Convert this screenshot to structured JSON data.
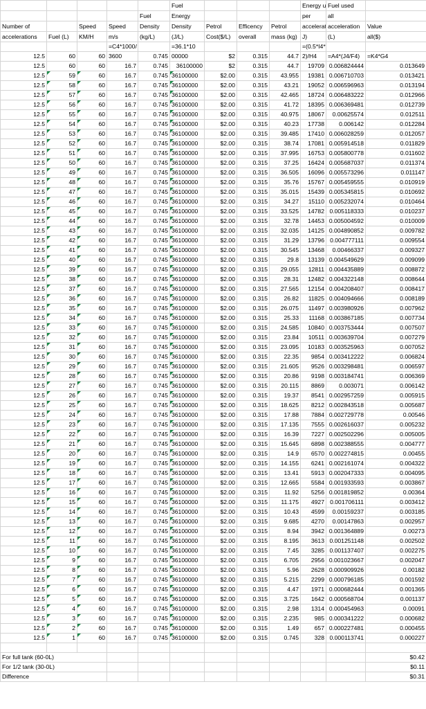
{
  "headers": {
    "row1": [
      "",
      "",
      "",
      "",
      "Fuel",
      "",
      "",
      "",
      "Energy used",
      "Fuel used",
      ""
    ],
    "row2": [
      "",
      "",
      "",
      "Fuel",
      "Energy",
      "",
      "",
      "",
      "per",
      "all",
      ""
    ],
    "row3": [
      "Number of",
      "",
      "Speed",
      "Speed",
      "Density",
      "Density",
      "Petrol",
      "Efficency",
      "Petrol",
      "acceleration(",
      "acceleration",
      "Value"
    ],
    "row4": [
      "accelerations",
      "Fuel (L)",
      "KM/H",
      "m/s",
      "(kg/L)",
      "(J/L)",
      "Cost($/L)",
      "overall",
      "mass (kg)",
      "J)",
      "(L)",
      "all($)"
    ],
    "formula_row": [
      "",
      "",
      "",
      "=C4*1000/",
      "",
      "=36.1*10",
      "",
      "",
      "",
      "=(0.5*I4*D4^",
      "",
      ""
    ]
  },
  "first_row": [
    "12.5",
    "60",
    "60",
    "3600",
    "0.745",
    "00000",
    "$2",
    "0.315",
    "44.7",
    "2)/H4",
    "=A4*(J4/F4)",
    "=K4*G4"
  ],
  "second_row": [
    "12.5",
    "60",
    "60",
    "16.7",
    "0.745",
    "36100000",
    "$2",
    "0.315",
    "44.7",
    "19709",
    "0.006824444",
    "0.013649"
  ],
  "rows": [
    [
      "12.5",
      "59",
      "60",
      "16.7",
      "0.745",
      "36100000",
      "$2.00",
      "0.315",
      "43.955",
      "19381",
      "0.006710703",
      "0.013421"
    ],
    [
      "12.5",
      "58",
      "60",
      "16.7",
      "0.745",
      "36100000",
      "$2.00",
      "0.315",
      "43.21",
      "19052",
      "0.006596963",
      "0.013194"
    ],
    [
      "12.5",
      "57",
      "60",
      "16.7",
      "0.745",
      "36100000",
      "$2.00",
      "0.315",
      "42.465",
      "18724",
      "0.006483222",
      "0.012966"
    ],
    [
      "12.5",
      "56",
      "60",
      "16.7",
      "0.745",
      "36100000",
      "$2.00",
      "0.315",
      "41.72",
      "18395",
      "0.006369481",
      "0.012739"
    ],
    [
      "12.5",
      "55",
      "60",
      "16.7",
      "0.745",
      "36100000",
      "$2.00",
      "0.315",
      "40.975",
      "18067",
      "0.00625574",
      "0.012511"
    ],
    [
      "12.5",
      "54",
      "60",
      "16.7",
      "0.745",
      "36100000",
      "$2.00",
      "0.315",
      "40.23",
      "17738",
      "0.006142",
      "0.012284"
    ],
    [
      "12.5",
      "53",
      "60",
      "16.7",
      "0.745",
      "36100000",
      "$2.00",
      "0.315",
      "39.485",
      "17410",
      "0.006028259",
      "0.012057"
    ],
    [
      "12.5",
      "52",
      "60",
      "16.7",
      "0.745",
      "36100000",
      "$2.00",
      "0.315",
      "38.74",
      "17081",
      "0.005914518",
      "0.011829"
    ],
    [
      "12.5",
      "51",
      "60",
      "16.7",
      "0.745",
      "36100000",
      "$2.00",
      "0.315",
      "37.995",
      "16753",
      "0.005800778",
      "0.011602"
    ],
    [
      "12.5",
      "50",
      "60",
      "16.7",
      "0.745",
      "36100000",
      "$2.00",
      "0.315",
      "37.25",
      "16424",
      "0.005687037",
      "0.011374"
    ],
    [
      "12.5",
      "49",
      "60",
      "16.7",
      "0.745",
      "36100000",
      "$2.00",
      "0.315",
      "36.505",
      "16096",
      "0.005573296",
      "0.011147"
    ],
    [
      "12.5",
      "48",
      "60",
      "16.7",
      "0.745",
      "36100000",
      "$2.00",
      "0.315",
      "35.76",
      "15767",
      "0.005459555",
      "0.010919"
    ],
    [
      "12.5",
      "47",
      "60",
      "16.7",
      "0.745",
      "36100000",
      "$2.00",
      "0.315",
      "35.015",
      "15439",
      "0.005345815",
      "0.010692"
    ],
    [
      "12.5",
      "46",
      "60",
      "16.7",
      "0.745",
      "36100000",
      "$2.00",
      "0.315",
      "34.27",
      "15110",
      "0.005232074",
      "0.010464"
    ],
    [
      "12.5",
      "45",
      "60",
      "16.7",
      "0.745",
      "36100000",
      "$2.00",
      "0.315",
      "33.525",
      "14782",
      "0.005118333",
      "0.010237"
    ],
    [
      "12.5",
      "44",
      "60",
      "16.7",
      "0.745",
      "36100000",
      "$2.00",
      "0.315",
      "32.78",
      "14453",
      "0.005004592",
      "0.010009"
    ],
    [
      "12.5",
      "43",
      "60",
      "16.7",
      "0.745",
      "36100000",
      "$2.00",
      "0.315",
      "32.035",
      "14125",
      "0.004890852",
      "0.009782"
    ],
    [
      "12.5",
      "42",
      "60",
      "16.7",
      "0.745",
      "36100000",
      "$2.00",
      "0.315",
      "31.29",
      "13796",
      "0.004777111",
      "0.009554"
    ],
    [
      "12.5",
      "41",
      "60",
      "16.7",
      "0.745",
      "36100000",
      "$2.00",
      "0.315",
      "30.545",
      "13468",
      "0.00466337",
      "0.009327"
    ],
    [
      "12.5",
      "40",
      "60",
      "16.7",
      "0.745",
      "36100000",
      "$2.00",
      "0.315",
      "29.8",
      "13139",
      "0.004549629",
      "0.009099"
    ],
    [
      "12.5",
      "39",
      "60",
      "16.7",
      "0.745",
      "36100000",
      "$2.00",
      "0.315",
      "29.055",
      "12811",
      "0.004435889",
      "0.008872"
    ],
    [
      "12.5",
      "38",
      "60",
      "16.7",
      "0.745",
      "36100000",
      "$2.00",
      "0.315",
      "28.31",
      "12482",
      "0.004322148",
      "0.008644"
    ],
    [
      "12.5",
      "37",
      "60",
      "16.7",
      "0.745",
      "36100000",
      "$2.00",
      "0.315",
      "27.565",
      "12154",
      "0.004208407",
      "0.008417"
    ],
    [
      "12.5",
      "36",
      "60",
      "16.7",
      "0.745",
      "36100000",
      "$2.00",
      "0.315",
      "26.82",
      "11825",
      "0.004094666",
      "0.008189"
    ],
    [
      "12.5",
      "35",
      "60",
      "16.7",
      "0.745",
      "36100000",
      "$2.00",
      "0.315",
      "26.075",
      "11497",
      "0.003980926",
      "0.007962"
    ],
    [
      "12.5",
      "34",
      "60",
      "16.7",
      "0.745",
      "36100000",
      "$2.00",
      "0.315",
      "25.33",
      "11168",
      "0.003867185",
      "0.007734"
    ],
    [
      "12.5",
      "33",
      "60",
      "16.7",
      "0.745",
      "36100000",
      "$2.00",
      "0.315",
      "24.585",
      "10840",
      "0.003753444",
      "0.007507"
    ],
    [
      "12.5",
      "32",
      "60",
      "16.7",
      "0.745",
      "36100000",
      "$2.00",
      "0.315",
      "23.84",
      "10511",
      "0.003639704",
      "0.007279"
    ],
    [
      "12.5",
      "31",
      "60",
      "16.7",
      "0.745",
      "36100000",
      "$2.00",
      "0.315",
      "23.095",
      "10183",
      "0.003525963",
      "0.007052"
    ],
    [
      "12.5",
      "30",
      "60",
      "16.7",
      "0.745",
      "36100000",
      "$2.00",
      "0.315",
      "22.35",
      "9854",
      "0.003412222",
      "0.006824"
    ],
    [
      "12.5",
      "29",
      "60",
      "16.7",
      "0.745",
      "36100000",
      "$2.00",
      "0.315",
      "21.605",
      "9526",
      "0.003298481",
      "0.006597"
    ],
    [
      "12.5",
      "28",
      "60",
      "16.7",
      "0.745",
      "36100000",
      "$2.00",
      "0.315",
      "20.86",
      "9198",
      "0.003184741",
      "0.006369"
    ],
    [
      "12.5",
      "27",
      "60",
      "16.7",
      "0.745",
      "36100000",
      "$2.00",
      "0.315",
      "20.115",
      "8869",
      "0.003071",
      "0.006142"
    ],
    [
      "12.5",
      "26",
      "60",
      "16.7",
      "0.745",
      "36100000",
      "$2.00",
      "0.315",
      "19.37",
      "8541",
      "0.002957259",
      "0.005915"
    ],
    [
      "12.5",
      "25",
      "60",
      "16.7",
      "0.745",
      "36100000",
      "$2.00",
      "0.315",
      "18.625",
      "8212",
      "0.002843518",
      "0.005687"
    ],
    [
      "12.5",
      "24",
      "60",
      "16.7",
      "0.745",
      "36100000",
      "$2.00",
      "0.315",
      "17.88",
      "7884",
      "0.002729778",
      "0.00546"
    ],
    [
      "12.5",
      "23",
      "60",
      "16.7",
      "0.745",
      "36100000",
      "$2.00",
      "0.315",
      "17.135",
      "7555",
      "0.002616037",
      "0.005232"
    ],
    [
      "12.5",
      "22",
      "60",
      "16.7",
      "0.745",
      "36100000",
      "$2.00",
      "0.315",
      "16.39",
      "7227",
      "0.002502296",
      "0.005005"
    ],
    [
      "12.5",
      "21",
      "60",
      "16.7",
      "0.745",
      "36100000",
      "$2.00",
      "0.315",
      "15.645",
      "6898",
      "0.002388555",
      "0.004777"
    ],
    [
      "12.5",
      "20",
      "60",
      "16.7",
      "0.745",
      "36100000",
      "$2.00",
      "0.315",
      "14.9",
      "6570",
      "0.002274815",
      "0.00455"
    ],
    [
      "12.5",
      "19",
      "60",
      "16.7",
      "0.745",
      "36100000",
      "$2.00",
      "0.315",
      "14.155",
      "6241",
      "0.002161074",
      "0.004322"
    ],
    [
      "12.5",
      "18",
      "60",
      "16.7",
      "0.745",
      "36100000",
      "$2.00",
      "0.315",
      "13.41",
      "5913",
      "0.002047333",
      "0.004095"
    ],
    [
      "12.5",
      "17",
      "60",
      "16.7",
      "0.745",
      "36100000",
      "$2.00",
      "0.315",
      "12.665",
      "5584",
      "0.001933593",
      "0.003867"
    ],
    [
      "12.5",
      "16",
      "60",
      "16.7",
      "0.745",
      "36100000",
      "$2.00",
      "0.315",
      "11.92",
      "5256",
      "0.001819852",
      "0.00364"
    ],
    [
      "12.5",
      "15",
      "60",
      "16.7",
      "0.745",
      "36100000",
      "$2.00",
      "0.315",
      "11.175",
      "4927",
      "0.001706111",
      "0.003412"
    ],
    [
      "12.5",
      "14",
      "60",
      "16.7",
      "0.745",
      "36100000",
      "$2.00",
      "0.315",
      "10.43",
      "4599",
      "0.00159237",
      "0.003185"
    ],
    [
      "12.5",
      "13",
      "60",
      "16.7",
      "0.745",
      "36100000",
      "$2.00",
      "0.315",
      "9.685",
      "4270",
      "0.00147863",
      "0.002957"
    ],
    [
      "12.5",
      "12",
      "60",
      "16.7",
      "0.745",
      "36100000",
      "$2.00",
      "0.315",
      "8.94",
      "3942",
      "0.001364889",
      "0.00273"
    ],
    [
      "12.5",
      "11",
      "60",
      "16.7",
      "0.745",
      "36100000",
      "$2.00",
      "0.315",
      "8.195",
      "3613",
      "0.001251148",
      "0.002502"
    ],
    [
      "12.5",
      "10",
      "60",
      "16.7",
      "0.745",
      "36100000",
      "$2.00",
      "0.315",
      "7.45",
      "3285",
      "0.001137407",
      "0.002275"
    ],
    [
      "12.5",
      "9",
      "60",
      "16.7",
      "0.745",
      "36100000",
      "$2.00",
      "0.315",
      "6.705",
      "2956",
      "0.001023667",
      "0.002047"
    ],
    [
      "12.5",
      "8",
      "60",
      "16.7",
      "0.745",
      "36100000",
      "$2.00",
      "0.315",
      "5.96",
      "2628",
      "0.000909926",
      "0.00182"
    ],
    [
      "12.5",
      "7",
      "60",
      "16.7",
      "0.745",
      "36100000",
      "$2.00",
      "0.315",
      "5.215",
      "2299",
      "0.000796185",
      "0.001592"
    ],
    [
      "12.5",
      "6",
      "60",
      "16.7",
      "0.745",
      "36100000",
      "$2.00",
      "0.315",
      "4.47",
      "1971",
      "0.000682444",
      "0.001365"
    ],
    [
      "12.5",
      "5",
      "60",
      "16.7",
      "0.745",
      "36100000",
      "$2.00",
      "0.315",
      "3.725",
      "1642",
      "0.000568704",
      "0.001137"
    ],
    [
      "12.5",
      "4",
      "60",
      "16.7",
      "0.745",
      "36100000",
      "$2.00",
      "0.315",
      "2.98",
      "1314",
      "0.000454963",
      "0.00091"
    ],
    [
      "12.5",
      "3",
      "60",
      "16.7",
      "0.745",
      "36100000",
      "$2.00",
      "0.315",
      "2.235",
      "985",
      "0.000341222",
      "0.000682"
    ],
    [
      "12.5",
      "2",
      "60",
      "16.7",
      "0.745",
      "36100000",
      "$2.00",
      "0.315",
      "1.49",
      "657",
      "0.000227481",
      "0.000455"
    ],
    [
      "12.5",
      "1",
      "60",
      "16.7",
      "0.745",
      "36100000",
      "$2.00",
      "0.315",
      "0.745",
      "328",
      "0.000113741",
      "0.000227"
    ]
  ],
  "footer": [
    {
      "label": "For full tank (60-0L)",
      "value": "$0.42"
    },
    {
      "label": "For 1/2 tank (30-0L)",
      "value": "$0.11"
    },
    {
      "label": "Difference",
      "value": "$0.31"
    }
  ],
  "colors": {
    "gridline": "#d4d4d4",
    "error_indicator": "#1d8c4a"
  }
}
